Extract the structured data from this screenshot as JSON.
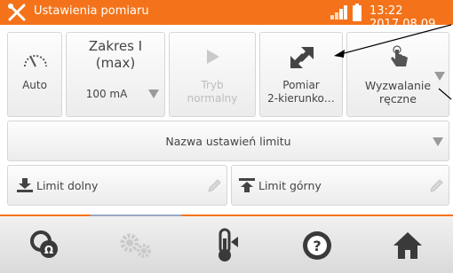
{
  "header": {
    "title": "Ustawienia pomiaru",
    "time": "13:22 2017.08.09",
    "accent_color": "#f4731a",
    "icons": [
      "tool-icon",
      "signal-icon",
      "battery-icon"
    ]
  },
  "settings": {
    "auto": {
      "label": "Auto",
      "icon": "gauge-icon"
    },
    "range": {
      "title_line1": "Zakres I",
      "title_line2": "(max)",
      "value": "100 mA"
    },
    "mode": {
      "line1": "Tryb",
      "line2": "normalny",
      "icon": "play-icon"
    },
    "direction": {
      "line1": "Pomiar",
      "line2": "2-kierunko…",
      "icon": "bidirectional-arrows-icon"
    },
    "trigger": {
      "line1": "Wyzwalanie",
      "line2": "ręczne",
      "icon": "hand-pointer-icon"
    }
  },
  "limit_name": {
    "label": "Nazwa ustawień limitu"
  },
  "limits": {
    "lower": {
      "label": "Limit dolny",
      "icon": "download-icon"
    },
    "upper": {
      "label": "Limit górny",
      "icon": "upload-icon"
    }
  },
  "bottom_nav": [
    "measurement-icon",
    "settings-gears-icon",
    "thermometer-icon",
    "help-icon",
    "home-icon"
  ]
}
